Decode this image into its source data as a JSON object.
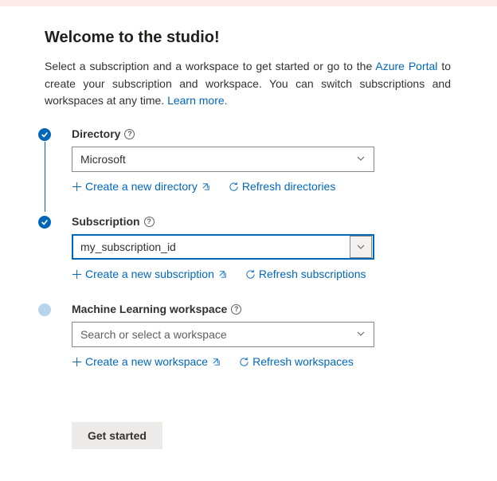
{
  "colors": {
    "link": "#0067b8"
  },
  "title": "Welcome to the studio!",
  "intro": {
    "part1": "Select a subscription and a workspace to get started or go to the ",
    "portal_link": "Azure Portal",
    "part2": " to create your subscription and workspace. You can switch subscriptions and workspaces at any time. ",
    "learn_more": "Learn more."
  },
  "directory": {
    "label": "Directory",
    "value": "Microsoft",
    "create": "Create a new directory",
    "refresh": "Refresh directories"
  },
  "subscription": {
    "label": "Subscription",
    "value": "my_subscription_id",
    "create": "Create a new subscription",
    "refresh": "Refresh subscriptions"
  },
  "workspace": {
    "label": "Machine Learning workspace",
    "placeholder": "Search or select a workspace",
    "create": "Create a new workspace",
    "refresh": "Refresh workspaces"
  },
  "get_started": "Get started"
}
